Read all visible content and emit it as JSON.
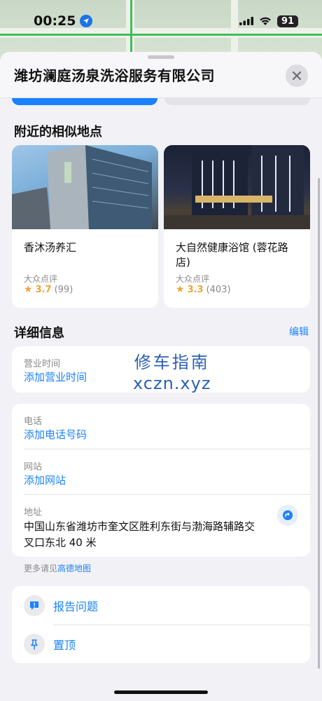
{
  "status_bar": {
    "time": "00:25",
    "battery": "91"
  },
  "place": {
    "title": "潍坊澜庭汤泉洗浴服务有限公司"
  },
  "nearby": {
    "heading": "附近的相似地点",
    "items": [
      {
        "name": "香沐汤养汇",
        "source": "大众点评",
        "rating": "3.7",
        "count": "(99)"
      },
      {
        "name": "大自然健康浴馆 (蓉花路店)",
        "source": "大众点评",
        "rating": "3.3",
        "count": "(403)"
      }
    ]
  },
  "details": {
    "heading": "详细信息",
    "edit_label": "编辑",
    "hours_label": "营业时间",
    "hours_action": "添加营业时间",
    "phone_label": "电话",
    "phone_action": "添加电话号码",
    "website_label": "网站",
    "website_action": "添加网站",
    "address_label": "地址",
    "address_value": "中国山东省潍坊市奎文区胜利东街与渤海路辅路交叉口东北 40 米"
  },
  "more": {
    "prefix": "更多请见",
    "link": "高德地图"
  },
  "actions": [
    {
      "label": "报告问题",
      "icon": "report-icon"
    },
    {
      "label": "置顶",
      "icon": "pin-icon"
    }
  ],
  "watermark": {
    "line1": "修车指南",
    "line2": "xczn.xyz"
  },
  "colors": {
    "accent": "#1a82ff",
    "rating": "#f2a33a",
    "sheet_bg": "#f2f2f6"
  }
}
